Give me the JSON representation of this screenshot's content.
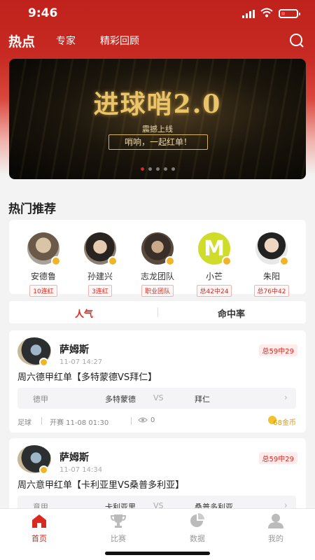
{
  "status": {
    "time": "9:46"
  },
  "nav": {
    "tabs": [
      "热点",
      "专家",
      "精彩回顾"
    ]
  },
  "banner": {
    "title": "进球哨2.0",
    "subtitle": "震撼上线",
    "slogan": "哨响，一起红单！"
  },
  "section": {
    "hot_title": "热门推荐"
  },
  "experts": [
    {
      "name": "安德鲁",
      "tag": "10连红"
    },
    {
      "name": "孙建兴",
      "tag": "3连红"
    },
    {
      "name": "志龙团队",
      "tag": "职业团队"
    },
    {
      "name": "小芒",
      "tag": "总42中24"
    },
    {
      "name": "朱阳",
      "tag": "总76中42"
    }
  ],
  "rank_tabs": {
    "popular": "人气",
    "hit_rate": "命中率"
  },
  "posts": [
    {
      "author": "萨姆斯",
      "time": "11-07 14:27",
      "record": "总59中29",
      "title": "周六德甲红单【多特蒙德VS拜仁】",
      "league": "德甲",
      "home": "多特蒙德",
      "vs": "VS",
      "away": "拜仁",
      "sport": "足球",
      "kickoff": "开赛  11-08 01:30",
      "views": "0",
      "price": "68金币"
    },
    {
      "author": "萨姆斯",
      "time": "11-07 14:34",
      "record": "总59中29",
      "title": "周六意甲红单【卡利亚里VS桑普多利亚】",
      "league": "意甲",
      "home": "卡利亚里",
      "vs": "VS",
      "away": "桑普多利亚"
    }
  ],
  "bottom_nav": [
    "首页",
    "比赛",
    "数据",
    "我的"
  ],
  "colors": {
    "brand_red": "#d8291f",
    "gold": "#e9c46a"
  }
}
